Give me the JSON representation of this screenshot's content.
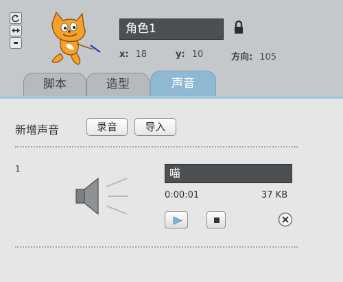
{
  "sprite": {
    "name": "角色1",
    "x_label": "x:",
    "x_value": "18",
    "y_label": "y:",
    "y_value": "10",
    "direction_label": "方向:",
    "direction_value": "105"
  },
  "rotation_buttons": [
    "rotate-all-around-icon",
    "left-right-flip-icon",
    "dont-rotate-icon"
  ],
  "tabs": [
    {
      "label": "脚本",
      "active": false
    },
    {
      "label": "造型",
      "active": false
    },
    {
      "label": "声音",
      "active": true
    }
  ],
  "sounds_panel": {
    "new_sound_label": "新增声音",
    "record_label": "录音",
    "import_label": "导入",
    "sounds": [
      {
        "index": "1",
        "name": "喵",
        "duration": "0:00:01",
        "size": "37 KB"
      }
    ]
  },
  "colors": {
    "active_tab": "#8fb8d2",
    "field_bg": "#4d5052",
    "panel_bg": "#e6e6e6"
  }
}
